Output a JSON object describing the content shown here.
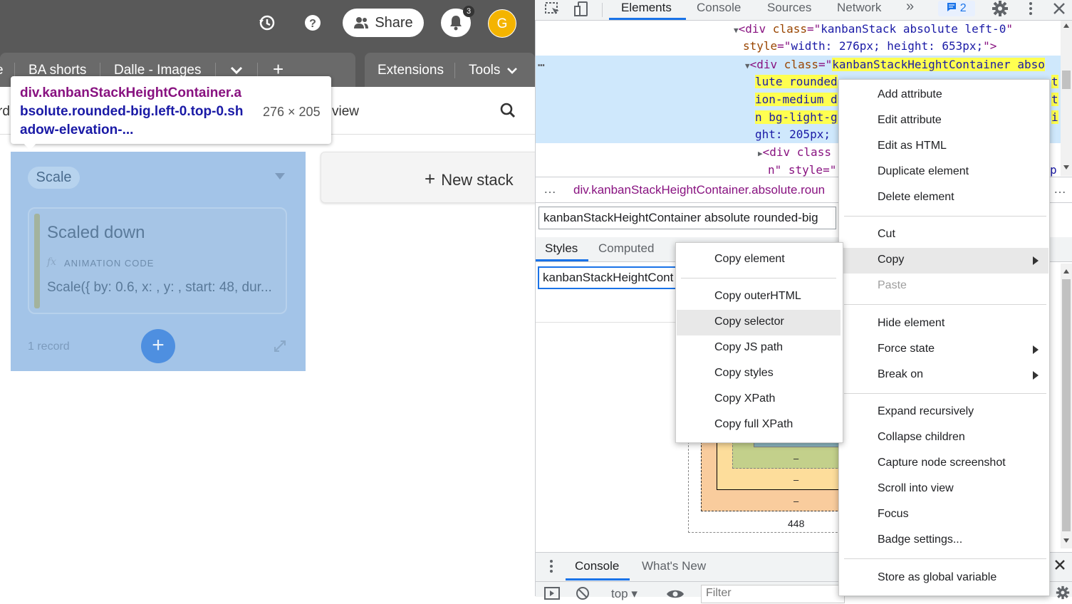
{
  "app": {
    "topbar": {
      "share_label": "Share",
      "notification_count": "3",
      "avatar_initial": "G"
    },
    "tabs": {
      "left_items": [
        "e",
        "BA shorts",
        "Dalle - Images"
      ],
      "right_items": [
        "Extensions",
        "Tools"
      ]
    },
    "viewbar": {
      "left_fragment": "rd",
      "right_fragment": "view"
    },
    "stack": {
      "name": "Scale",
      "record": {
        "title": "Scaled down",
        "fx": "fx",
        "field_label": "ANIMATION CODE",
        "field_value": "Scale({ by: 0.6, x: , y: , start: 48, dur..."
      },
      "record_count": "1 record",
      "add_label": "+"
    },
    "new_stack_label": "New stack",
    "tooltip": {
      "line1": "div.kanbanStackHeightContainer.a",
      "line2": "bsolute.rounded-big.left-0.top-0.sh",
      "line3": "adow-elevation-...",
      "size": "276 × 205"
    }
  },
  "devtools": {
    "tabs": [
      "Elements",
      "Console",
      "Sources",
      "Network"
    ],
    "more_tabs": "»",
    "message_count": "2",
    "dom": {
      "line1": {
        "tag_open": "<div ",
        "attr": "class",
        "eq": "=\"",
        "val": "kanbanStack absolute left-0",
        "end": "\""
      },
      "line2": {
        "attr": "style",
        "eq": "=\"",
        "val": "width: 276px; height: 653px;",
        "end": "\">"
      },
      "sel_line1_pre": "<div ",
      "sel_attr": "class",
      "sel_eq": "=\"",
      "sel_val1": "kanbanStackHeightContainer abso",
      "sel_val2": "lute rounded",
      "sel_val3": "ion-medium d",
      "sel_val4": "n bg-light-g",
      "sel_val5": "ght: 205px;",
      "sel_right1": "t",
      "sel_right3": "t",
      "sel_right4": "i",
      "child1": "<div class",
      "child2": "n\" style=\"",
      "child_right": "p",
      "dots": "…"
    },
    "breadcrumb": {
      "dots": "…",
      "text": "div.kanbanStackHeightContainer.absolute.roun"
    },
    "class_input_value": "kanbanStackHeightContainer absolute rounded-big",
    "styles_tabs": [
      "Styles",
      "Computed"
    ],
    "filter_value": "kanbanStackHeightCont",
    "box_model": {
      "dash1": "–",
      "dash2": "–",
      "dash3": "–",
      "width_value": "448"
    },
    "drawer": {
      "tabs": [
        "Console",
        "What's New"
      ],
      "context": "top",
      "filter_placeholder": "Filter"
    }
  },
  "main_menu": {
    "items_group1": [
      "Add attribute",
      "Edit attribute",
      "Edit as HTML",
      "Duplicate element",
      "Delete element"
    ],
    "items_group2": [
      "Cut",
      "Copy",
      "Paste"
    ],
    "items_group3": [
      "Hide element",
      "Force state",
      "Break on"
    ],
    "items_group4": [
      "Expand recursively",
      "Collapse children",
      "Capture node screenshot",
      "Scroll into view",
      "Focus",
      "Badge settings..."
    ],
    "items_group5": [
      "Store as global variable"
    ]
  },
  "copy_submenu": {
    "items_group1": [
      "Copy element"
    ],
    "items_group2": [
      "Copy outerHTML",
      "Copy selector",
      "Copy JS path",
      "Copy styles",
      "Copy XPath",
      "Copy full XPath"
    ]
  },
  "colors": {
    "accent": "#1a73e8",
    "stack_overlay": "#a3c4e8",
    "highlight": "#ffff50",
    "avatar": "#f4b400"
  }
}
